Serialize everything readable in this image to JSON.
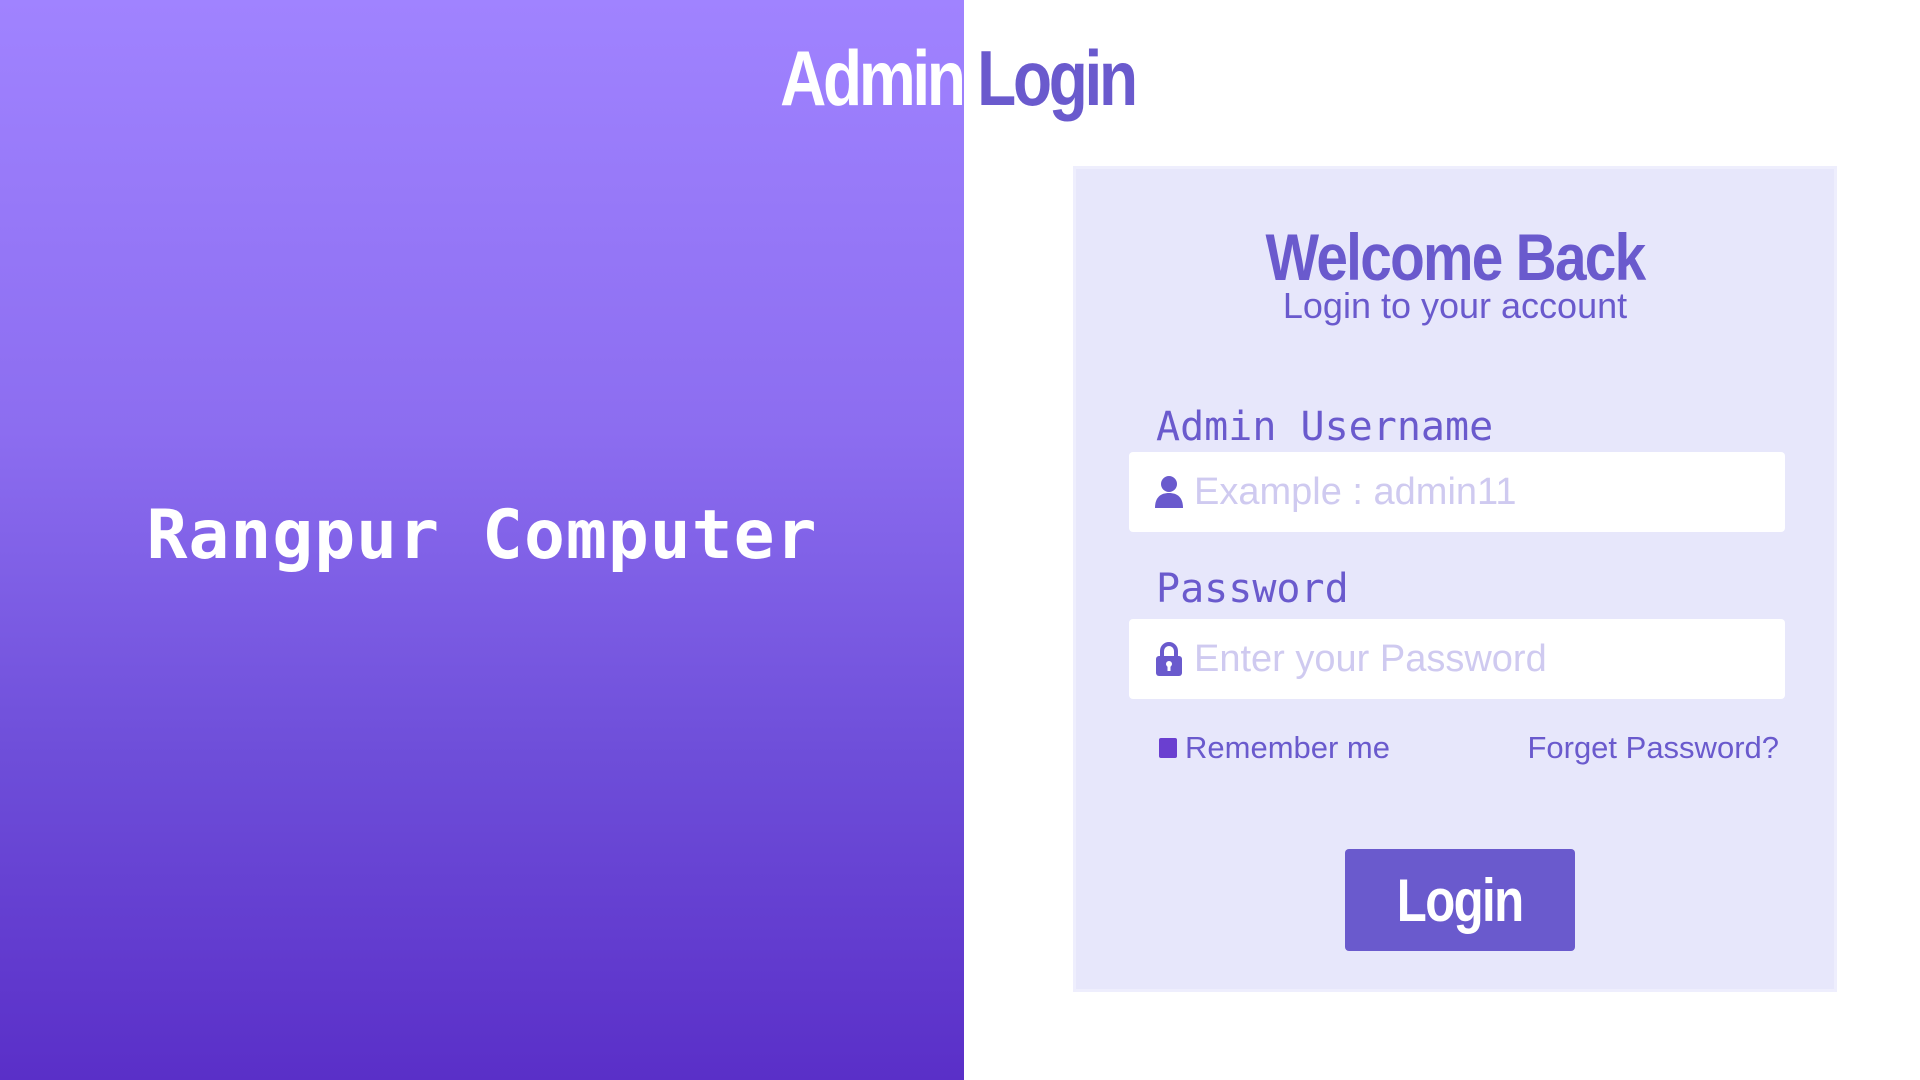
{
  "page": {
    "title_part1": "Admin",
    "title_part2": "Login"
  },
  "brand": {
    "name": "Rangpur Computer"
  },
  "card": {
    "welcome": "Welcome Back",
    "subtitle": "Login to your account",
    "username": {
      "label": "Admin Username",
      "placeholder": "Example : admin11",
      "value": "",
      "icon": "user-icon"
    },
    "password": {
      "label": "Password",
      "placeholder": "Enter your Password",
      "value": "",
      "icon": "lock-icon"
    },
    "remember_label": "Remember me",
    "remember_checked": true,
    "forgot_label": "Forget Password?",
    "login_label": "Login"
  },
  "colors": {
    "accent": "#6a5acd",
    "gradient_top": "#a083ff",
    "gradient_bottom": "#5a2fc8",
    "card_bg": "#e7e7fb"
  }
}
